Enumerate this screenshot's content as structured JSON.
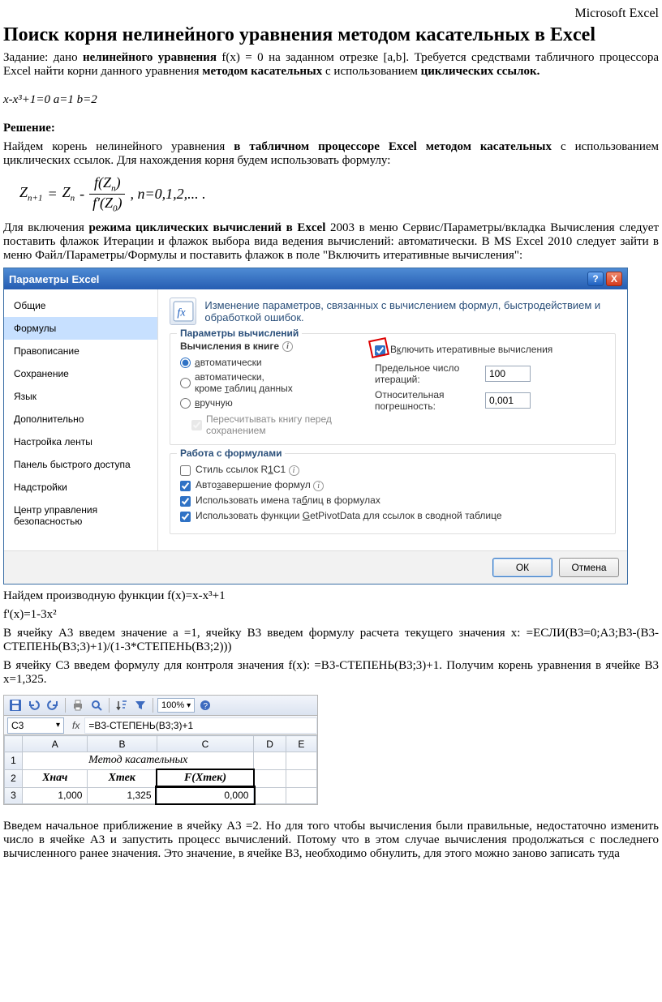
{
  "header": {
    "ms_excel": "Microsoft Excel"
  },
  "title": "Поиск корня нелинейного уравнения методом касательных в Excel",
  "intro": {
    "p1_a": "Задание: дано ",
    "p1_b": "нелинейного уравнения",
    "p1_c": " f(x) = 0 на заданном отрезке [a,b]. Требуется средствами табличного процессора Excel найти корни данного уравнения ",
    "p1_d": "методом касательных",
    "p1_e": " с использованием ",
    "p1_f": "циклических ссылок."
  },
  "equation": "x-x³+1=0     a=1  b=2",
  "solution_label": "Решение:",
  "solution": {
    "p1_a": "Найдем корень нелинейного уравнения ",
    "p1_b": "в табличном процессоре Excel  методом касательных",
    "p1_c": " с использованием циклических ссылок. Для нахождения корня будем использовать формулу:"
  },
  "formula": {
    "lhs": "Z",
    "lhs_sub": "n+1",
    "eq": " = ",
    "rhs_a": "Z",
    "rhs_a_sub": "n",
    "minus": " - ",
    "num_a": "f(Z",
    "num_sub": "n",
    "num_b": ")",
    "den_a": "f'(Z",
    "den_sub": "0",
    "den_b": ")",
    "tail": " , n=0,1,2,...  ."
  },
  "para2": {
    "a": " Для включения ",
    "b": "режима циклических вычислений в Excel",
    "c": "2003 в меню Сервис/Параметры/вкладка Вычисления следует поставить флажок Итерации и флажок выбора вида ведения вычислений: автоматически. В MS Excel 2010 следует зайти в меню Файл/Параметры/Формулы и поставить флажок в поле \"Включить итеративные вычисления\":"
  },
  "dialog": {
    "title": "Параметры Excel",
    "close": "X",
    "help": "?",
    "sidebar": [
      "Общие",
      "Формулы",
      "Правописание",
      "Сохранение",
      "Язык",
      "Дополнительно",
      "Настройка ленты",
      "Панель быстрого доступа",
      "Надстройки",
      "Центр управления безопасностью"
    ],
    "selected_index": 1,
    "head_text": "Изменение параметров, связанных с вычислением формул, быстродействием и обработкой ошибок.",
    "group1": {
      "legend": "Параметры вычислений",
      "left_label": "Вычисления в книге",
      "radios": [
        {
          "label": "автоматически",
          "checked": true,
          "u": "а"
        },
        {
          "label": "автоматически, кроме таблиц данных",
          "checked": false,
          "u": "т"
        },
        {
          "label": "вручную",
          "checked": false,
          "u": "в"
        }
      ],
      "recalc": "Пересчитывать книгу перед сохранением",
      "chk_iter": "Включить итеративные вычисления",
      "max_iter_label": "Предельное число итераций:",
      "max_iter": "100",
      "eps_label": "Относительная погрешность:",
      "eps": "0,001"
    },
    "group2": {
      "legend": "Работа с формулами",
      "chks": [
        {
          "label": "Стиль ссылок R1C1",
          "checked": false,
          "u": "1",
          "info": true
        },
        {
          "label": "Автозавершение формул",
          "checked": true,
          "u": "з",
          "info": true
        },
        {
          "label": "Использовать имена таблиц в формулах",
          "checked": true,
          "u": "б"
        },
        {
          "label": "Использовать функции GetPivotData для ссылок в сводной таблице",
          "checked": true,
          "u": "G"
        }
      ]
    },
    "ok": "ОК",
    "cancel": "Отмена"
  },
  "after_dialog": {
    "p1": "Найдем производную функции f(x)=x-x³+1",
    "p2": "f'(x)=1-3x²",
    "p3": "В ячейку А3 введем значение а =1, ячейку В3 введем формулу расчета текущего значения х: =ЕСЛИ(B3=0;A3;B3-(B3-СТЕПЕНЬ(B3;3)+1)/(1-3*СТЕПЕНЬ(B3;2)))",
    "p4": "В ячейку С3 введем формулу для контроля значения f(x): =B3-СТЕПЕНЬ(B3;3)+1. Получим корень уравнения в ячейке В3   х=1,325."
  },
  "excel": {
    "zoom": "100%",
    "namebox": "C3",
    "fx": "fx",
    "formula": "=B3-СТЕПЕНЬ(B3;3)+1",
    "cols": [
      "A",
      "B",
      "C",
      "D",
      "E"
    ],
    "row1_title": "Метод касательных",
    "heads": [
      "Хнач",
      "Хтек",
      "F(Хтек)"
    ],
    "vals": [
      "1,000",
      "1,325",
      "0,000"
    ]
  },
  "bottom": "Введем начальное приближение в ячейку А3 =2. Но для того чтобы вычисления были правильные, недостаточно изменить число в ячейке А3 и запустить процесс вычислений. Потому что в этом случае вычисления продолжаться с последнего вычисленного ранее значения. Это значение,  в ячейке В3, необходимо обнулить, для этого можно заново записать туда"
}
